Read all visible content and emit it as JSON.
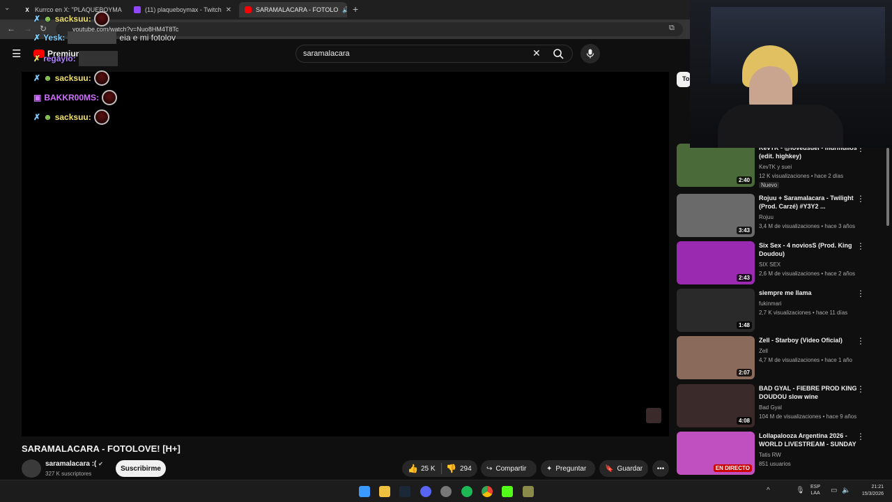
{
  "browser": {
    "tabs": [
      {
        "label": "Kurrco en X: \"PLAQUEBOYMA",
        "icon": "x-logo-icon"
      },
      {
        "label": "(11) plaqueboymax - Twitch",
        "icon": "twitch-icon"
      },
      {
        "label": "SARAMALACARA - FOTOLO",
        "icon": "youtube-icon"
      }
    ],
    "url": "youtube.com/watch?v=Nuo8HM4T8Tc"
  },
  "youtube": {
    "search_value": "saramalacara",
    "premium_label": "Premium",
    "video_title": "SARAMALACARA - FOTOLOVE! [H+]",
    "channel_name": "saramalacara :(",
    "subscribers": "327 K suscriptores",
    "subscribe_label": "Suscribirme",
    "likes": "25 K",
    "dislikes": "294",
    "share_label": "Compartir",
    "ask_label": "Preguntar",
    "save_label": "Guardar",
    "chip_label": "To"
  },
  "recommendations": [
    {
      "title": "KevTK - @lovedsuei - murmullos (edit. highkey)",
      "channel": "KevTK y suei",
      "meta": "12 K visualizaciones • hace 2 días",
      "badge": "Nuevo",
      "duration": "2:40",
      "thumb": "#4a6a3a"
    },
    {
      "title": "Rojuu + Saramalacara - Twilight (Prod. Carzé) #Y3Y2 ...",
      "channel": "Rojuu",
      "meta": "3,4 M de visualizaciones • hace 3 años",
      "badge": "",
      "duration": "3:43",
      "thumb": "#6a6a6a"
    },
    {
      "title": "Six Sex - 4 noviosS (Prod. King Doudou)",
      "channel": "SIX SEX",
      "meta": "2,6 M de visualizaciones • hace 2 años",
      "badge": "",
      "duration": "2:43",
      "thumb": "#9a2ab0"
    },
    {
      "title": "siempre me llama",
      "channel": "fukinmari",
      "meta": "2,7 K visualizaciones • hace 11 días",
      "badge": "",
      "duration": "1:48",
      "thumb": "#2a2a2a"
    },
    {
      "title": "Zell - Starboy (Video Oficial)",
      "channel": "Zell",
      "meta": "4,7 M de visualizaciones • hace 1 año",
      "badge": "",
      "duration": "2:07",
      "thumb": "#8a6a5a"
    },
    {
      "title": "BAD GYAL - FIEBRE PROD KING DOUDOU slow wine",
      "channel": "Bad Gyal",
      "meta": "104 M de visualizaciones • hace 9 años",
      "badge": "",
      "duration": "4:08",
      "thumb": "#3a2a2a"
    },
    {
      "title": "Lollapalooza Argentina 2026 - WORLD LIVESTREAM - SUNDAY",
      "channel": "Tatis RW",
      "meta": "851 usuarios",
      "badge": "",
      "duration": "",
      "thumb": "#c050c0",
      "live": "EN DIRECTO"
    }
  ],
  "chat": [
    {
      "user": "sacksuu:",
      "color": "#f0e070"
    },
    {
      "user": "Yesk:",
      "color": "#7fd0ff",
      "text": "eia e mi fotolov"
    },
    {
      "user": "regaylo:",
      "color": "#b080ff"
    },
    {
      "user": "sacksuu:",
      "color": "#f0e070"
    },
    {
      "user": "BAKKR00MS:",
      "color": "#d070ff"
    },
    {
      "user": "sacksuu:",
      "color": "#f0e070"
    }
  ],
  "taskbar": {
    "lang": "ESP",
    "lang2": "LAA",
    "time": "21:21",
    "date": "15/3/2026"
  }
}
